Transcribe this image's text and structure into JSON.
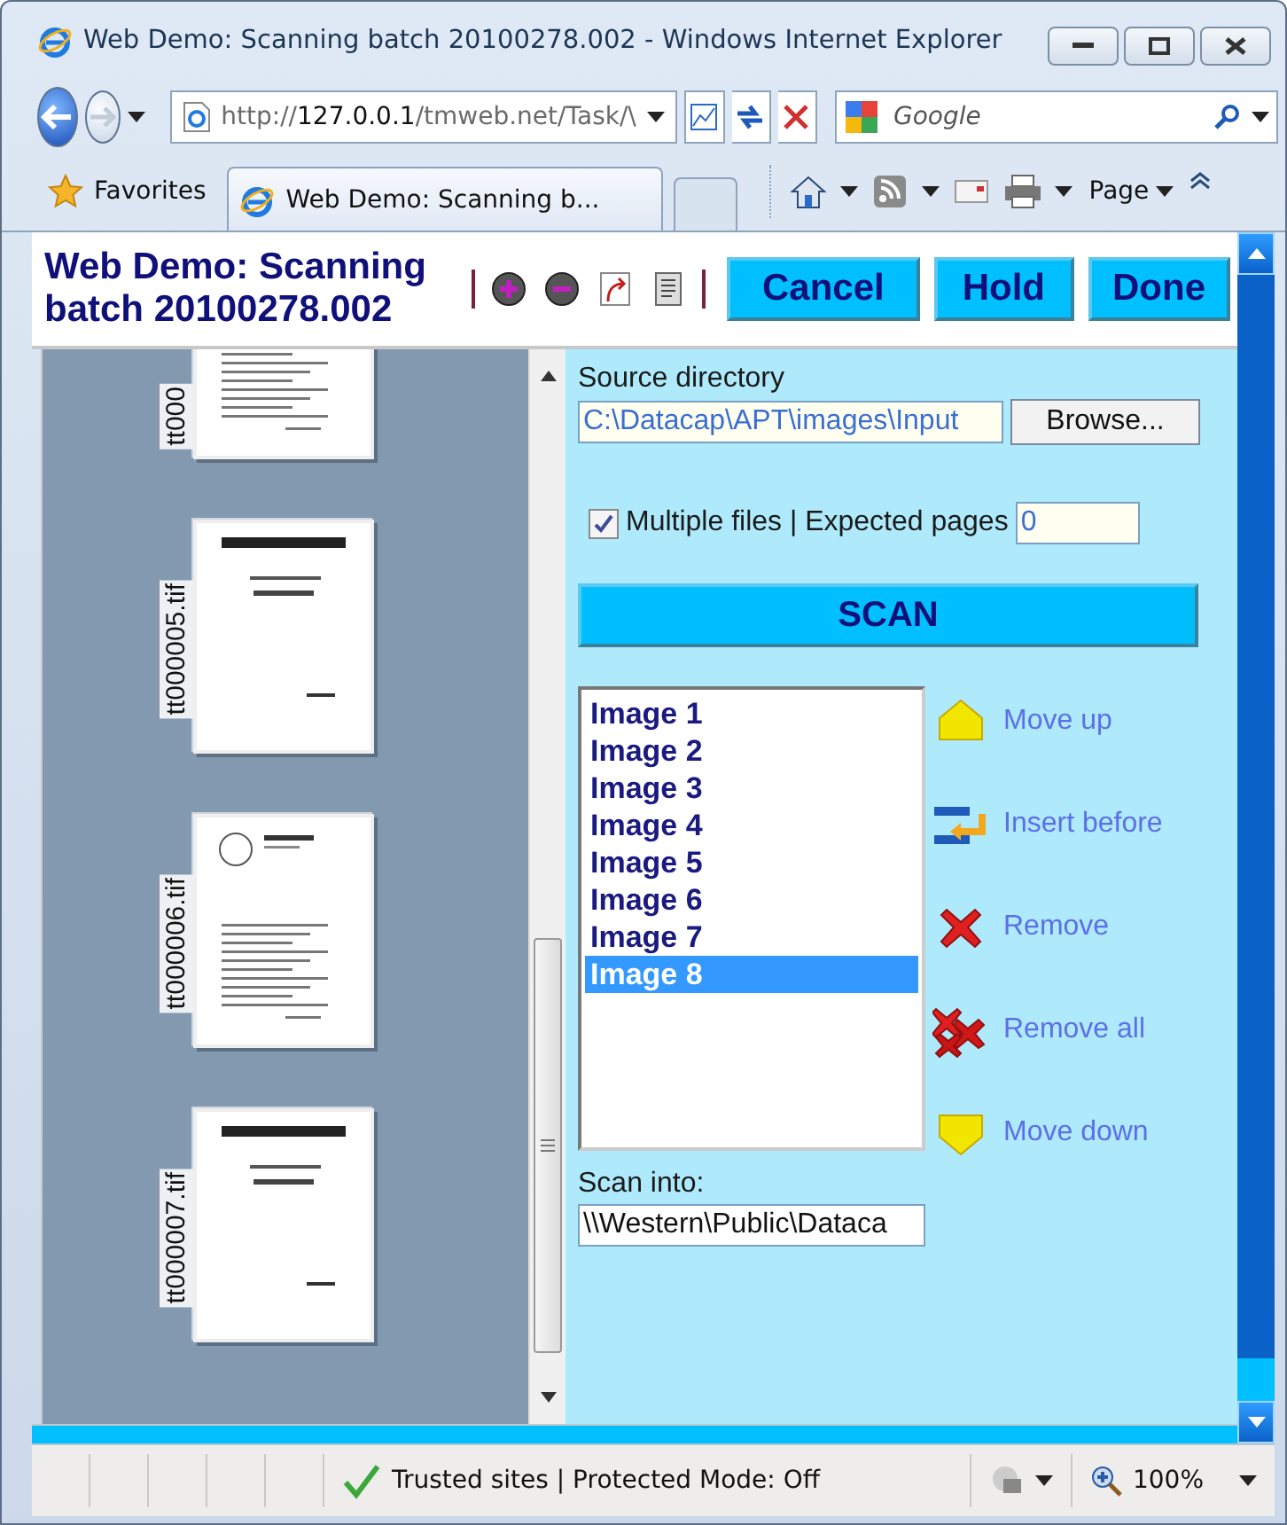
{
  "window": {
    "title": "Web Demo: Scanning batch 20100278.002 - Windows Internet Explorer"
  },
  "address_bar": {
    "url": "http://**127.0.0.1**/tmweb.net/Task/\\"
  },
  "search": {
    "placeholder": "Google"
  },
  "favorites": {
    "label": "Favorites"
  },
  "tabs": [
    {
      "label": "Web Demo: Scanning b...",
      "selected": true
    }
  ],
  "command_bar": {
    "page_menu": "Page"
  },
  "page": {
    "title": "Web Demo: Scanning batch 20100278.002",
    "buttons": [
      "Cancel",
      "Hold",
      "Done"
    ],
    "thumbnails": [
      {
        "label": "tt000"
      },
      {
        "label": "tt000005.tif"
      },
      {
        "label": "tt000006.tif"
      },
      {
        "label": "tt000007.tif"
      }
    ],
    "source_directory": {
      "label": "Source directory",
      "value": "C:\\Datacap\\APT\\images\\Input",
      "button": "Browse..."
    },
    "multiple_files": {
      "label": "Multiple files | Expected pages",
      "checked": true,
      "expected_pages": "0"
    },
    "scan_button": "SCAN",
    "images": [
      {
        "label": "Image 1",
        "selected": false
      },
      {
        "label": "Image 2",
        "selected": false
      },
      {
        "label": "Image 3",
        "selected": false
      },
      {
        "label": "Image 4",
        "selected": false
      },
      {
        "label": "Image 5",
        "selected": false
      },
      {
        "label": "Image 6",
        "selected": false
      },
      {
        "label": "Image 7",
        "selected": false
      },
      {
        "label": "Image 8",
        "selected": true
      }
    ],
    "actions": [
      {
        "label": "Move up",
        "kind": "up"
      },
      {
        "label": "Insert before",
        "kind": "insert"
      },
      {
        "label": "Remove",
        "kind": "remove"
      },
      {
        "label": "Remove all",
        "kind": "remove_all"
      },
      {
        "label": "Move down",
        "kind": "down"
      }
    ],
    "scan_into": {
      "label": "Scan into:",
      "value": "\\\\Western\\Public\\Dataca"
    }
  },
  "status_bar": {
    "zone": "Trusted sites | Protected Mode: Off",
    "zoom": "100%"
  }
}
